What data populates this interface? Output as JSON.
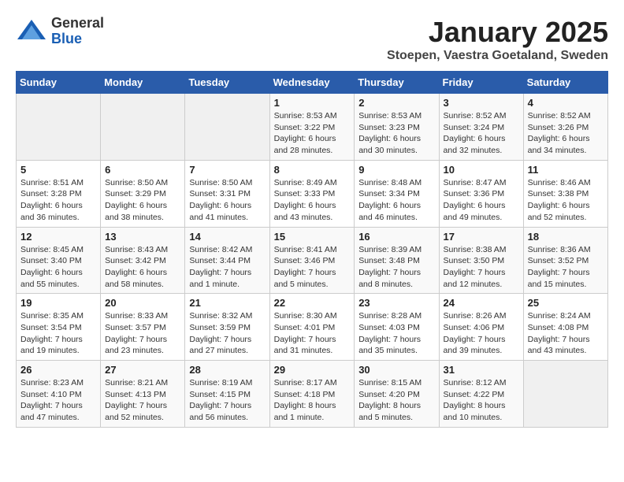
{
  "logo": {
    "general": "General",
    "blue": "Blue"
  },
  "title": "January 2025",
  "subtitle": "Stoepen, Vaestra Goetaland, Sweden",
  "weekdays": [
    "Sunday",
    "Monday",
    "Tuesday",
    "Wednesday",
    "Thursday",
    "Friday",
    "Saturday"
  ],
  "weeks": [
    [
      {
        "day": "",
        "info": ""
      },
      {
        "day": "",
        "info": ""
      },
      {
        "day": "",
        "info": ""
      },
      {
        "day": "1",
        "info": "Sunrise: 8:53 AM\nSunset: 3:22 PM\nDaylight: 6 hours\nand 28 minutes."
      },
      {
        "day": "2",
        "info": "Sunrise: 8:53 AM\nSunset: 3:23 PM\nDaylight: 6 hours\nand 30 minutes."
      },
      {
        "day": "3",
        "info": "Sunrise: 8:52 AM\nSunset: 3:24 PM\nDaylight: 6 hours\nand 32 minutes."
      },
      {
        "day": "4",
        "info": "Sunrise: 8:52 AM\nSunset: 3:26 PM\nDaylight: 6 hours\nand 34 minutes."
      }
    ],
    [
      {
        "day": "5",
        "info": "Sunrise: 8:51 AM\nSunset: 3:28 PM\nDaylight: 6 hours\nand 36 minutes."
      },
      {
        "day": "6",
        "info": "Sunrise: 8:50 AM\nSunset: 3:29 PM\nDaylight: 6 hours\nand 38 minutes."
      },
      {
        "day": "7",
        "info": "Sunrise: 8:50 AM\nSunset: 3:31 PM\nDaylight: 6 hours\nand 41 minutes."
      },
      {
        "day": "8",
        "info": "Sunrise: 8:49 AM\nSunset: 3:33 PM\nDaylight: 6 hours\nand 43 minutes."
      },
      {
        "day": "9",
        "info": "Sunrise: 8:48 AM\nSunset: 3:34 PM\nDaylight: 6 hours\nand 46 minutes."
      },
      {
        "day": "10",
        "info": "Sunrise: 8:47 AM\nSunset: 3:36 PM\nDaylight: 6 hours\nand 49 minutes."
      },
      {
        "day": "11",
        "info": "Sunrise: 8:46 AM\nSunset: 3:38 PM\nDaylight: 6 hours\nand 52 minutes."
      }
    ],
    [
      {
        "day": "12",
        "info": "Sunrise: 8:45 AM\nSunset: 3:40 PM\nDaylight: 6 hours\nand 55 minutes."
      },
      {
        "day": "13",
        "info": "Sunrise: 8:43 AM\nSunset: 3:42 PM\nDaylight: 6 hours\nand 58 minutes."
      },
      {
        "day": "14",
        "info": "Sunrise: 8:42 AM\nSunset: 3:44 PM\nDaylight: 7 hours\nand 1 minute."
      },
      {
        "day": "15",
        "info": "Sunrise: 8:41 AM\nSunset: 3:46 PM\nDaylight: 7 hours\nand 5 minutes."
      },
      {
        "day": "16",
        "info": "Sunrise: 8:39 AM\nSunset: 3:48 PM\nDaylight: 7 hours\nand 8 minutes."
      },
      {
        "day": "17",
        "info": "Sunrise: 8:38 AM\nSunset: 3:50 PM\nDaylight: 7 hours\nand 12 minutes."
      },
      {
        "day": "18",
        "info": "Sunrise: 8:36 AM\nSunset: 3:52 PM\nDaylight: 7 hours\nand 15 minutes."
      }
    ],
    [
      {
        "day": "19",
        "info": "Sunrise: 8:35 AM\nSunset: 3:54 PM\nDaylight: 7 hours\nand 19 minutes."
      },
      {
        "day": "20",
        "info": "Sunrise: 8:33 AM\nSunset: 3:57 PM\nDaylight: 7 hours\nand 23 minutes."
      },
      {
        "day": "21",
        "info": "Sunrise: 8:32 AM\nSunset: 3:59 PM\nDaylight: 7 hours\nand 27 minutes."
      },
      {
        "day": "22",
        "info": "Sunrise: 8:30 AM\nSunset: 4:01 PM\nDaylight: 7 hours\nand 31 minutes."
      },
      {
        "day": "23",
        "info": "Sunrise: 8:28 AM\nSunset: 4:03 PM\nDaylight: 7 hours\nand 35 minutes."
      },
      {
        "day": "24",
        "info": "Sunrise: 8:26 AM\nSunset: 4:06 PM\nDaylight: 7 hours\nand 39 minutes."
      },
      {
        "day": "25",
        "info": "Sunrise: 8:24 AM\nSunset: 4:08 PM\nDaylight: 7 hours\nand 43 minutes."
      }
    ],
    [
      {
        "day": "26",
        "info": "Sunrise: 8:23 AM\nSunset: 4:10 PM\nDaylight: 7 hours\nand 47 minutes."
      },
      {
        "day": "27",
        "info": "Sunrise: 8:21 AM\nSunset: 4:13 PM\nDaylight: 7 hours\nand 52 minutes."
      },
      {
        "day": "28",
        "info": "Sunrise: 8:19 AM\nSunset: 4:15 PM\nDaylight: 7 hours\nand 56 minutes."
      },
      {
        "day": "29",
        "info": "Sunrise: 8:17 AM\nSunset: 4:18 PM\nDaylight: 8 hours\nand 1 minute."
      },
      {
        "day": "30",
        "info": "Sunrise: 8:15 AM\nSunset: 4:20 PM\nDaylight: 8 hours\nand 5 minutes."
      },
      {
        "day": "31",
        "info": "Sunrise: 8:12 AM\nSunset: 4:22 PM\nDaylight: 8 hours\nand 10 minutes."
      },
      {
        "day": "",
        "info": ""
      }
    ]
  ]
}
